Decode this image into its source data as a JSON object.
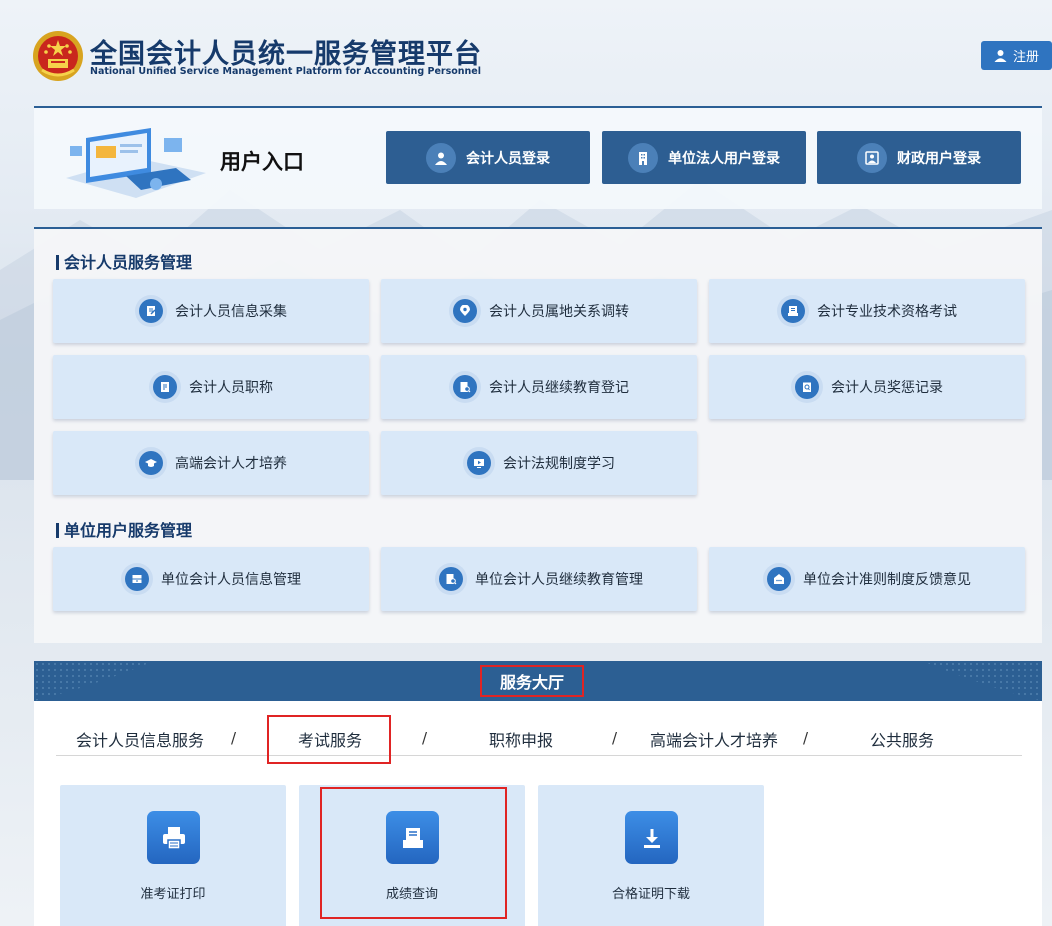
{
  "header": {
    "title_cn": "全国会计人员统一服务管理平台",
    "title_en": "National Unified Service Management Platform for Accounting Personnel",
    "register_label": "注册",
    "register_icon": "user-icon"
  },
  "entry": {
    "title": "用户入口",
    "logins": [
      {
        "label": "会计人员登录",
        "icon": "person-icon"
      },
      {
        "label": "单位法人用户登录",
        "icon": "building-icon"
      },
      {
        "label": "财政用户登录",
        "icon": "portrait-icon"
      }
    ]
  },
  "accountant_services": {
    "title": "会计人员服务管理",
    "items": [
      {
        "label": "会计人员信息采集",
        "icon": "document-edit-icon"
      },
      {
        "label": "会计人员属地关系调转",
        "icon": "location-user-icon"
      },
      {
        "label": "会计专业技术资格考试",
        "icon": "exam-paper-icon"
      },
      {
        "label": "会计人员职称",
        "icon": "certificate-icon"
      },
      {
        "label": "会计人员继续教育登记",
        "icon": "document-search-icon"
      },
      {
        "label": "会计人员奖惩记录",
        "icon": "clipboard-search-icon"
      },
      {
        "label": "高端会计人才培养",
        "icon": "graduation-cap-icon"
      },
      {
        "label": "会计法规制度学习",
        "icon": "video-play-icon"
      }
    ]
  },
  "unit_services": {
    "title": "单位用户服务管理",
    "items": [
      {
        "label": "单位会计人员信息管理",
        "icon": "drawer-icon"
      },
      {
        "label": "单位会计人员继续教育管理",
        "icon": "document-search-icon"
      },
      {
        "label": "单位会计准则制度反馈意见",
        "icon": "feedback-box-icon"
      }
    ]
  },
  "service_hall": {
    "title": "服务大厅",
    "tabs": [
      "会计人员信息服务",
      "考试服务",
      "职称申报",
      "高端会计人才培养",
      "公共服务"
    ],
    "separator": "/",
    "active_tab": "考试服务",
    "services": [
      {
        "label": "准考证打印",
        "icon": "printer-icon"
      },
      {
        "label": "成绩查询",
        "icon": "score-document-icon"
      },
      {
        "label": "合格证明下载",
        "icon": "download-icon"
      }
    ]
  },
  "colors": {
    "primary": "#2d5e92",
    "accent_blue": "#2f74c0",
    "card_bg": "#d9e8f8",
    "highlight_red": "#e02424",
    "title_navy": "#163a6b"
  }
}
